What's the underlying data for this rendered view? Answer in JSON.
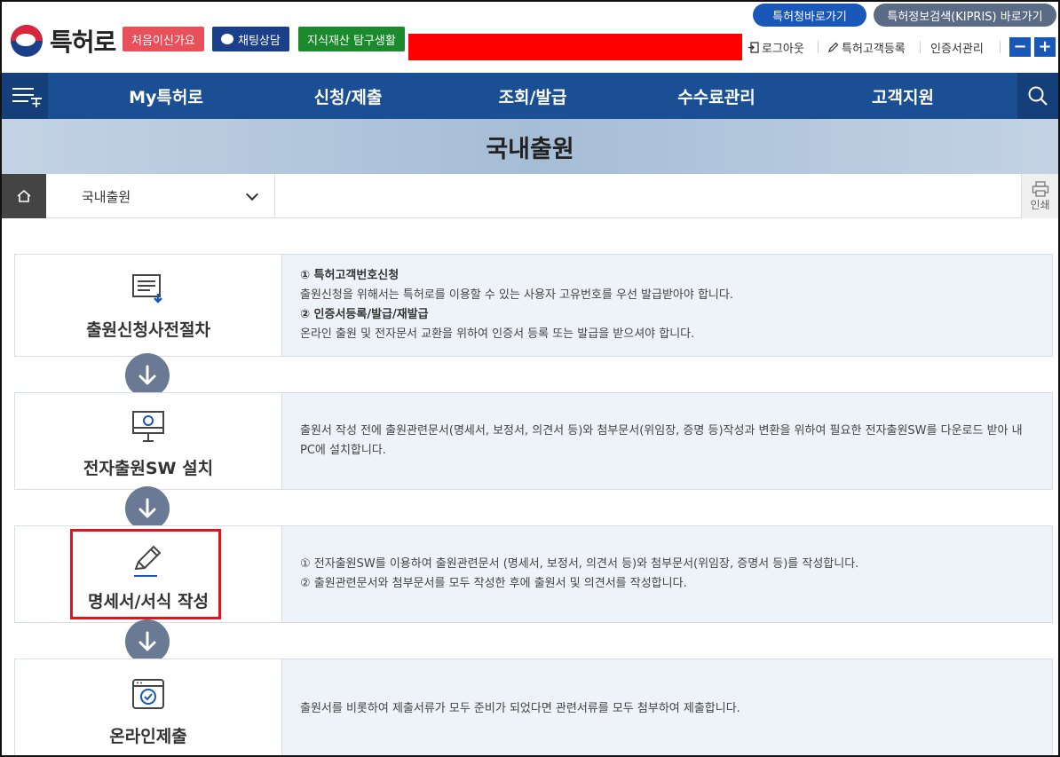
{
  "header": {
    "logo_text": "특허로",
    "pill_first": "처음이신가요",
    "pill_chat": "채팅상담",
    "pill_ip": "지식재산 탐구생활",
    "shortcut_kipo": "특허청바로가기",
    "shortcut_kipris": "특허정보검색(KIPRIS) 바로가기",
    "logout": "로그아웃",
    "register": "특허고객등록",
    "cert": "인증서관리",
    "zoom_minus": "−",
    "zoom_plus": "+"
  },
  "nav": {
    "items": [
      {
        "label": "My특허로"
      },
      {
        "label": "신청/제출"
      },
      {
        "label": "조회/발급"
      },
      {
        "label": "수수료관리"
      },
      {
        "label": "고객지원"
      }
    ]
  },
  "banner": {
    "title": "국내출원"
  },
  "breadcrumb": {
    "selected": "국내출원",
    "print_label": "인쇄"
  },
  "steps": [
    {
      "title": "출원신청사전절차",
      "icon": "document-download-icon",
      "lines": [
        {
          "text": "① 특허고객번호신청",
          "bold": true
        },
        {
          "text": "출원신청을 위해서는 특허로를 이용할 수 있는 사용자 고유번호를 우선 발급받아야 합니다.",
          "bold": false
        },
        {
          "text": "② 인증서등록/발급/재발급",
          "bold": true
        },
        {
          "text": "온라인 출원 및 전자문서 교환을 위하여 인증서 등록 또는 발급을 받으셔야 합니다.",
          "bold": false
        }
      ]
    },
    {
      "title": "전자출원SW 설치",
      "icon": "computer-monitor-icon",
      "lines": [
        {
          "text": "출원서 작성 전에 출원관련문서(명세서, 보정서, 의견서 등)와 첨부문서(위임장, 증명 등)작성과 변환을 위하여 필요한 전자출원SW를 다운로드 받아 내 PC에 설치합니다.",
          "bold": false
        }
      ]
    },
    {
      "title": "명세서/서식 작성",
      "icon": "pencil-icon",
      "lines": [
        {
          "text": "① 전자출원SW를 이용하여 출원관련문서 (명세서, 보정서, 의견서 등)와 첨부문서(위임장, 증명서 등)를 작성합니다.",
          "bold": false
        },
        {
          "text": "② 출원관련문서와 첨부문서를 모두 작성한 후에 출원서 및 의견서를 작성합니다.",
          "bold": false
        }
      ]
    },
    {
      "title": "온라인제출",
      "icon": "browser-check-icon",
      "lines": [
        {
          "text": "출원서를 비롯하여 제출서류가 모두 준비가 되었다면 관련서류를 모두 첨부하여 제출합니다.",
          "bold": false
        }
      ]
    }
  ],
  "colors": {
    "nav_bg": "#1a4f94",
    "accent_blue": "#1957b8",
    "highlight_red": "#e0141e",
    "arrow_gray": "#6a7a94"
  }
}
